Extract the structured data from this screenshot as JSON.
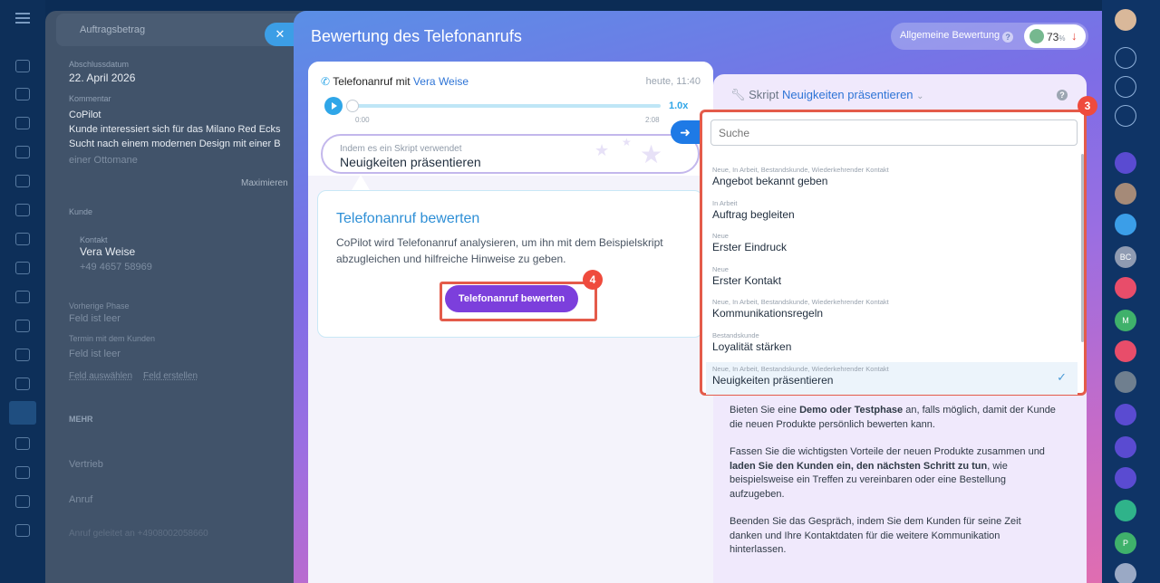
{
  "background": {
    "labels": {
      "amount": "Auftragsbetrag",
      "close_date": "Abschlussdatum",
      "comment": "Kommentar",
      "customer": "Kunde",
      "contact": "Kontakt",
      "prev_phase": "Vorherige Phase",
      "term": "Termin mit dem Kunden",
      "more": "MEHR"
    },
    "values": {
      "close_date": "22. April 2026",
      "comment_title": "CoPilot",
      "comment_line1": "Kunde interessiert sich für das Milano Red Ecks",
      "comment_line2": "Sucht nach einem modernen Design mit einer B",
      "comment_line3": "einer Ottomane",
      "maximize": "Maximieren",
      "contact_name": "Vera Weise",
      "contact_phone": "+49 4657 58969",
      "prev_phase": "Feld ist leer",
      "term": "Feld ist leer",
      "select_field": "Feld auswählen",
      "create_field": "Feld erstellen",
      "sales": "Vertrieb",
      "call": "Anruf",
      "incoming_call": "Anruf geleitet an +4908002058660"
    }
  },
  "modal": {
    "title": "Bewertung des Telefonanrufs",
    "overall_label": "Allgemeine Bewertung",
    "overall_value": "73",
    "overall_unit": "%"
  },
  "call": {
    "title_prefix": "Telefonanruf mit",
    "contact": "Vera Weise",
    "time": "heute, 11:40",
    "speed": "1.0x",
    "start": "0:00",
    "end": "2:08",
    "script_label": "Indem es ein Skript verwendet",
    "script_value": "Neuigkeiten präsentieren"
  },
  "evaluate": {
    "title": "Telefonanruf bewerten",
    "description": "CoPilot wird Telefonanruf analysieren, um ihn mit dem Beispielskript abzugleichen und hilfreiche Hinweise zu geben.",
    "button": "Telefonanruf bewerten",
    "step_badge": "4"
  },
  "script_panel": {
    "label": "Skript",
    "selected": "Neuigkeiten präsentieren",
    "step_badge": "3",
    "text": {
      "p1_a": "Bieten Sie eine ",
      "p1_b": "Demo oder Testphase",
      "p1_c": " an, falls möglich, damit der Kunde die neuen Produkte persönlich bewerten kann.",
      "p2_a": "Fassen Sie die wichtigsten Vorteile der neuen Produkte zusammen und ",
      "p2_b": "laden Sie den Kunden ein, den nächsten Schritt zu tun",
      "p2_c": ", wie beispielsweise ein Treffen zu vereinbaren oder eine Bestellung aufzugeben.",
      "p3": "Beenden Sie das Gespräch, indem Sie dem Kunden für seine Zeit danken und Ihre Kontaktdaten für die weitere Kommunikation hinterlassen."
    }
  },
  "dropdown": {
    "search_placeholder": "Suche",
    "items": [
      {
        "tags": "Neue, In Arbeit, Bestandskunde, Wiederkehrender Kontakt",
        "name": "Angebot bekannt geben"
      },
      {
        "tags": "In Arbeit",
        "name": "Auftrag begleiten"
      },
      {
        "tags": "Neue",
        "name": "Erster Eindruck"
      },
      {
        "tags": "Neue",
        "name": "Erster Kontakt"
      },
      {
        "tags": "Neue, In Arbeit, Bestandskunde, Wiederkehrender Kontakt",
        "name": "Kommunikationsregeln"
      },
      {
        "tags": "Bestandskunde",
        "name": "Loyalität stärken"
      },
      {
        "tags": "Neue, In Arbeit, Bestandskunde, Wiederkehrender Kontakt",
        "name": "Neuigkeiten präsentieren"
      }
    ]
  },
  "rightbar": {
    "avatars": [
      "BC",
      "M",
      "P"
    ]
  }
}
